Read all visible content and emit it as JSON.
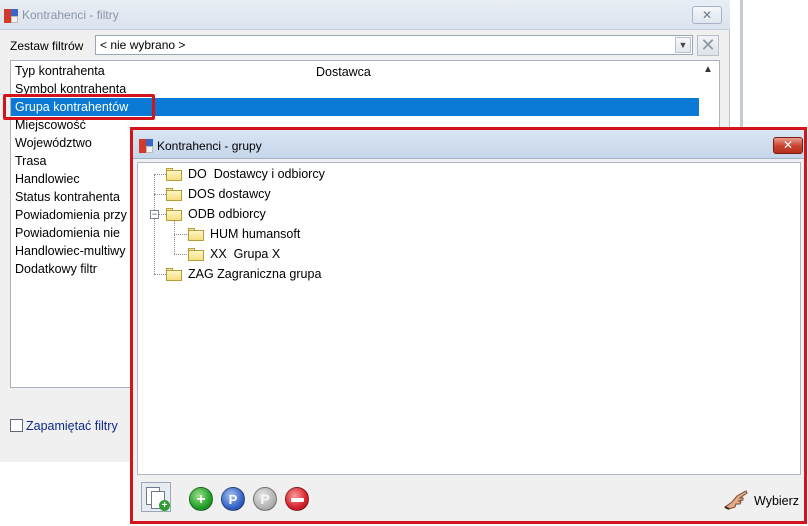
{
  "filters_window": {
    "title": "Kontrahenci - filtry",
    "close_glyph": "✕",
    "filter_set_label": "Zestaw filtrów",
    "filter_set_value": "< nie wybrano >",
    "clear_glyph": "✕",
    "rows": [
      {
        "label": "Typ kontrahenta",
        "value": "Dostawca"
      },
      {
        "label": "Symbol kontrahenta"
      },
      {
        "label": "Grupa kontrahentów",
        "selected": true
      },
      {
        "label": "Miejscowość"
      },
      {
        "label": "Województwo"
      },
      {
        "label": "Trasa"
      },
      {
        "label": "Handlowiec"
      },
      {
        "label": "Status kontrahenta"
      },
      {
        "label": "Powiadomienia przy"
      },
      {
        "label": "Powiadomienia nie"
      },
      {
        "label": "Handlowiec-multiwy"
      },
      {
        "label": "Dodatkowy filtr"
      }
    ],
    "remember_label": "Zapamiętać filtry",
    "remember_checked": false
  },
  "groups_dialog": {
    "title": "Kontrahenci - grupy",
    "close_glyph": "✕",
    "tree": [
      {
        "label": "DO  Dostawcy i odbiorcy"
      },
      {
        "label": "DOS dostawcy"
      },
      {
        "label": "ODB odbiorcy",
        "expanded": true,
        "children": [
          {
            "label": "HUM humansoft"
          },
          {
            "label": "XX  Grupa X"
          }
        ]
      },
      {
        "label": "ZAG Zagraniczna grupa"
      }
    ],
    "toolbar": {
      "add_glyph": "+",
      "edit_glyph": "P",
      "p_glyph": "P",
      "select_label": "Wybierz"
    }
  },
  "colors": {
    "selection": "#0a7ad6",
    "highlight_border": "#d4141b",
    "link_text": "#0c2a8c"
  }
}
